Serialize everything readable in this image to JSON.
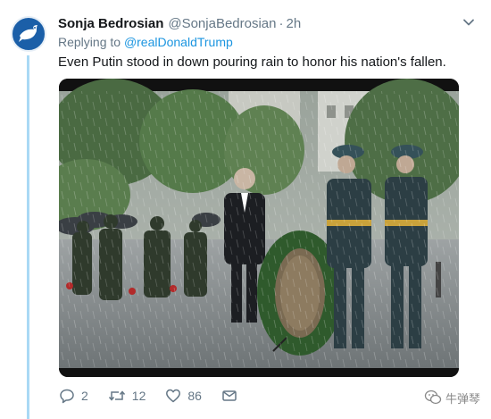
{
  "tweet": {
    "author_name": "Sonja Bedrosian",
    "author_handle": "@SonjaBedrosian",
    "separator": "·",
    "time": "2h",
    "reply_prefix": "Replying to",
    "reply_to": "@realDonaldTrump",
    "text": "Even Putin stood in down pouring rain to honor his nation's fallen."
  },
  "actions": {
    "reply_count": "2",
    "retweet_count": "12",
    "like_count": "86"
  },
  "icons": {
    "avatar": "dove-icon",
    "menu": "chevron-down-icon",
    "reply": "reply-icon",
    "retweet": "retweet-icon",
    "like": "heart-icon",
    "dm": "envelope-icon"
  },
  "watermark": {
    "text": "牛弹琴"
  },
  "colors": {
    "link": "#1b95e0",
    "muted": "#657786",
    "thread_line": "#a9d9f5",
    "avatar_bg": "#1b5fa8"
  }
}
